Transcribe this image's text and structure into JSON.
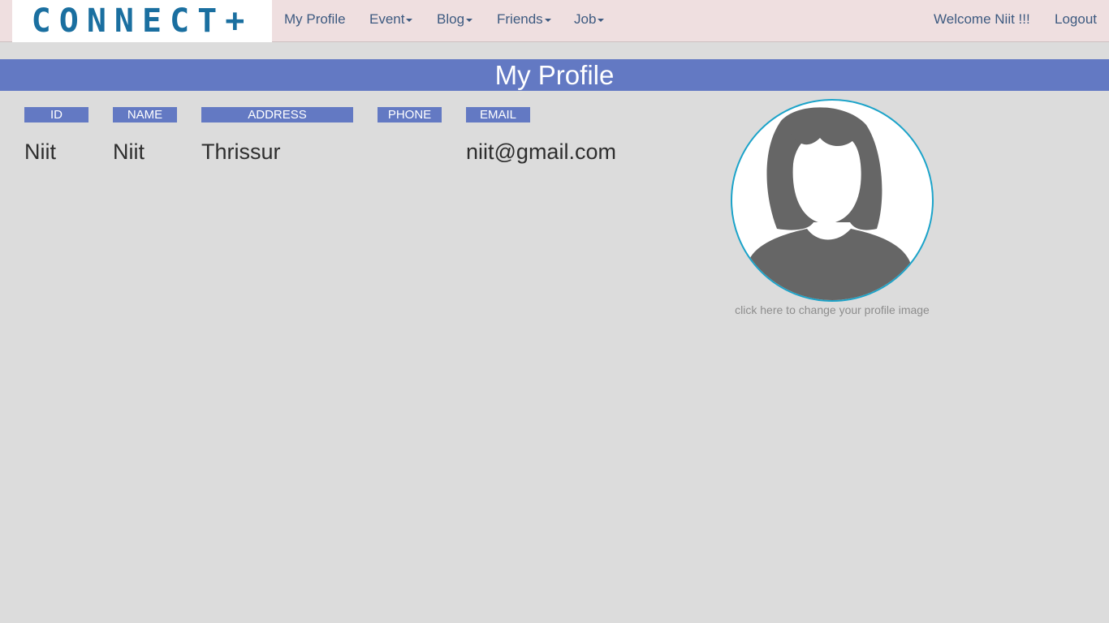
{
  "navbar": {
    "logo_text": "CONNECT+",
    "links": {
      "my_profile": "My Profile",
      "event": "Event",
      "blog": "Blog",
      "friends": "Friends",
      "job": "Job"
    },
    "welcome": "Welcome Niit !!!",
    "logout": "Logout"
  },
  "page": {
    "title": "My Profile"
  },
  "profile_table": {
    "headers": {
      "id": "ID",
      "name": "NAME",
      "address": "ADDRESS",
      "phone": "PHONE",
      "email": "EMAIL"
    },
    "row": {
      "id": "Niit",
      "name": "Niit",
      "address": "Thrissur",
      "phone": "",
      "email": "niit@gmail.com"
    }
  },
  "profile_image": {
    "icon": "female-avatar-icon",
    "caption": "click here to change your profile image"
  },
  "colors": {
    "navbar_bg": "#efdfe0",
    "accent": "#6379c3",
    "logo": "#1a6fa0",
    "avatar_border": "#1ba3c9",
    "page_bg": "#dcdcdc"
  }
}
